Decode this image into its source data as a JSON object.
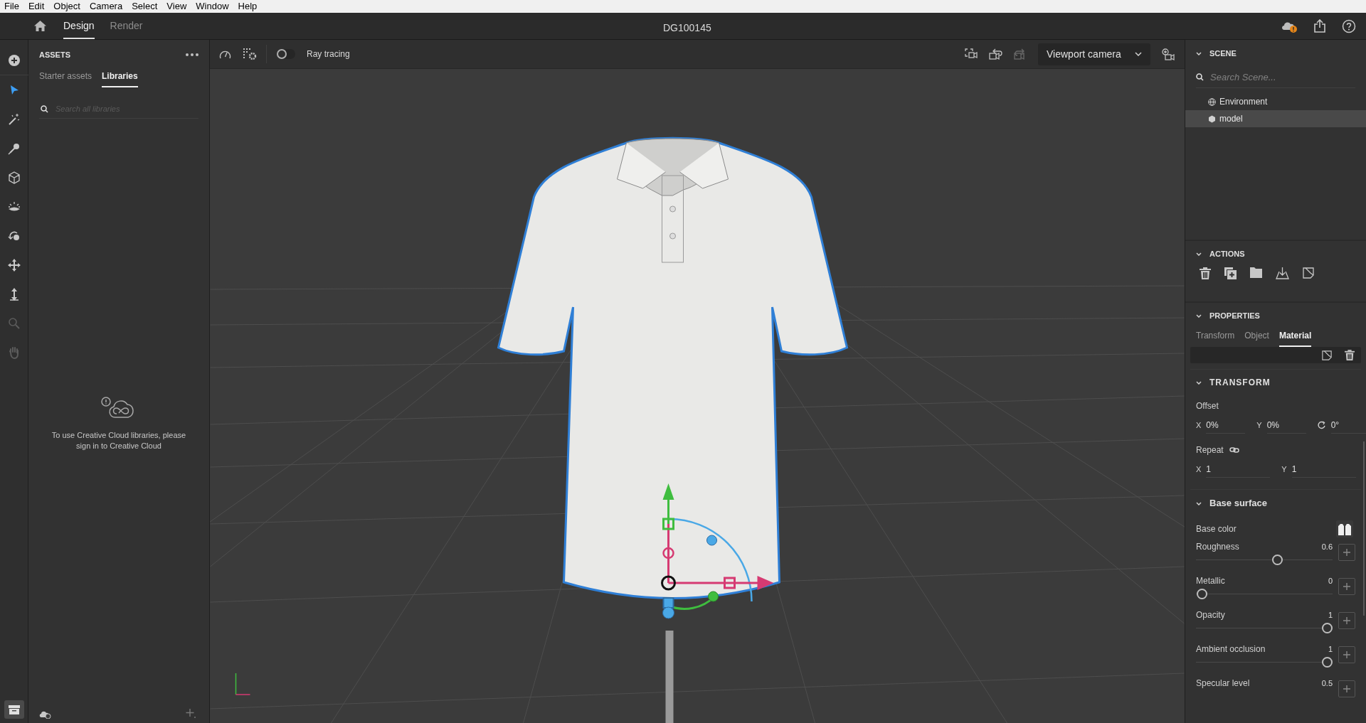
{
  "menu_bar": [
    "File",
    "Edit",
    "Object",
    "Camera",
    "Select",
    "View",
    "Window",
    "Help"
  ],
  "app_bar": {
    "tabs": [
      {
        "label": "Design",
        "selected": true
      },
      {
        "label": "Render",
        "selected": false
      }
    ],
    "title": "DG100145"
  },
  "tools": [
    {
      "selected": false,
      "disabled": false
    },
    {
      "selected": true,
      "disabled": false
    },
    {
      "selected": false,
      "disabled": false
    },
    {
      "selected": false,
      "disabled": false
    },
    {
      "selected": false,
      "disabled": false
    },
    {
      "selected": false,
      "disabled": false
    },
    {
      "selected": false,
      "disabled": false
    },
    {
      "selected": false,
      "disabled": false
    },
    {
      "selected": false,
      "disabled": false
    },
    {
      "selected": false,
      "disabled": true
    },
    {
      "selected": false,
      "disabled": true
    }
  ],
  "assets": {
    "title": "ASSETS",
    "tabs": [
      {
        "label": "Starter assets",
        "selected": false
      },
      {
        "label": "Libraries",
        "selected": true
      }
    ],
    "search": {
      "placeholder": "Search all libraries"
    },
    "message": "To use Creative Cloud libraries, please sign in to Creative Cloud"
  },
  "viewport_toolbar": {
    "ray_tracing": {
      "label": "Ray tracing",
      "on": false
    },
    "camera": "Viewport camera"
  },
  "scene": {
    "title": "SCENE",
    "search": {
      "placeholder": "Search Scene..."
    },
    "items": [
      {
        "label": "Environment",
        "kind": "environment",
        "selected": false
      },
      {
        "label": "model",
        "kind": "model",
        "selected": true
      }
    ]
  },
  "actions": {
    "title": "ACTIONS"
  },
  "properties": {
    "title": "PROPERTIES",
    "tabs": [
      {
        "label": "Transform",
        "selected": false
      },
      {
        "label": "Object",
        "selected": false
      },
      {
        "label": "Material",
        "selected": true
      }
    ]
  },
  "transform": {
    "title": "TRANSFORM",
    "offset": {
      "label": "Offset",
      "fields": [
        {
          "kind": "axis",
          "axis": "X",
          "value": "0%"
        },
        {
          "kind": "axis",
          "axis": "Y",
          "value": "0%"
        },
        {
          "kind": "angle",
          "value": "0°"
        }
      ]
    },
    "repeat": {
      "label": "Repeat",
      "fields": [
        {
          "kind": "axis",
          "axis": "X",
          "value": "1"
        },
        {
          "kind": "axis",
          "axis": "Y",
          "value": "1"
        }
      ]
    }
  },
  "base_surface": {
    "title": "Base surface",
    "base_color": {
      "label": "Base color"
    },
    "sliders": [
      {
        "label": "Roughness",
        "reading": "0.6",
        "level": 0.6
      },
      {
        "label": "Metallic",
        "reading": "0",
        "level": 0
      },
      {
        "label": "Opacity",
        "reading": "1",
        "level": 1
      },
      {
        "label": "Ambient occlusion",
        "reading": "1",
        "level": 1
      },
      {
        "label": "Specular level",
        "reading": "0.5"
      }
    ]
  }
}
